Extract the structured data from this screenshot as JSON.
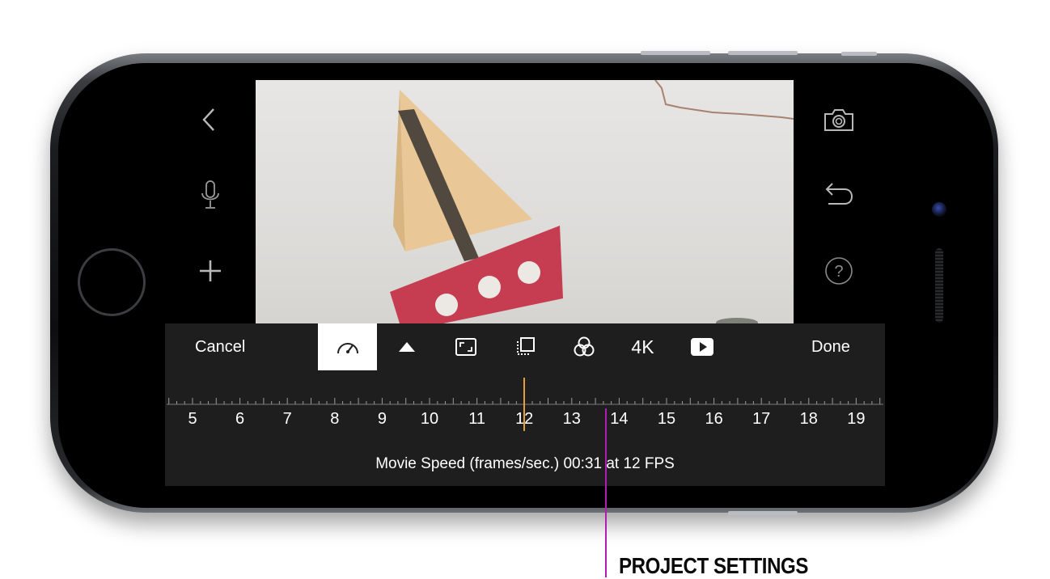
{
  "toolbar": {
    "cancel_label": "Cancel",
    "done_label": "Done",
    "resolution_label": "4K",
    "tools": [
      "speed-gauge",
      "triangle-up",
      "aspect-frame",
      "overlay-layers",
      "color-filters",
      "4K",
      "youtube-play"
    ]
  },
  "left_controls": [
    "back-chevron-icon",
    "microphone-icon",
    "plus-icon"
  ],
  "right_controls": [
    "camera-icon",
    "undo-icon",
    "help-icon"
  ],
  "ruler": {
    "ticks": [
      "5",
      "6",
      "7",
      "8",
      "9",
      "10",
      "11",
      "12",
      "13",
      "14",
      "15",
      "16",
      "17",
      "18",
      "19"
    ],
    "selected_value": 12
  },
  "status": {
    "caption": "Movie Speed (frames/sec.) 00:31 at 12 FPS"
  },
  "annotation": {
    "label": "PROJECT SETTINGS",
    "color": "#b21cb3"
  },
  "colors": {
    "panel": "#1e1e1f",
    "playhead": "#e0a13a",
    "sail": "#e9c796",
    "hull": "#c63d51"
  }
}
